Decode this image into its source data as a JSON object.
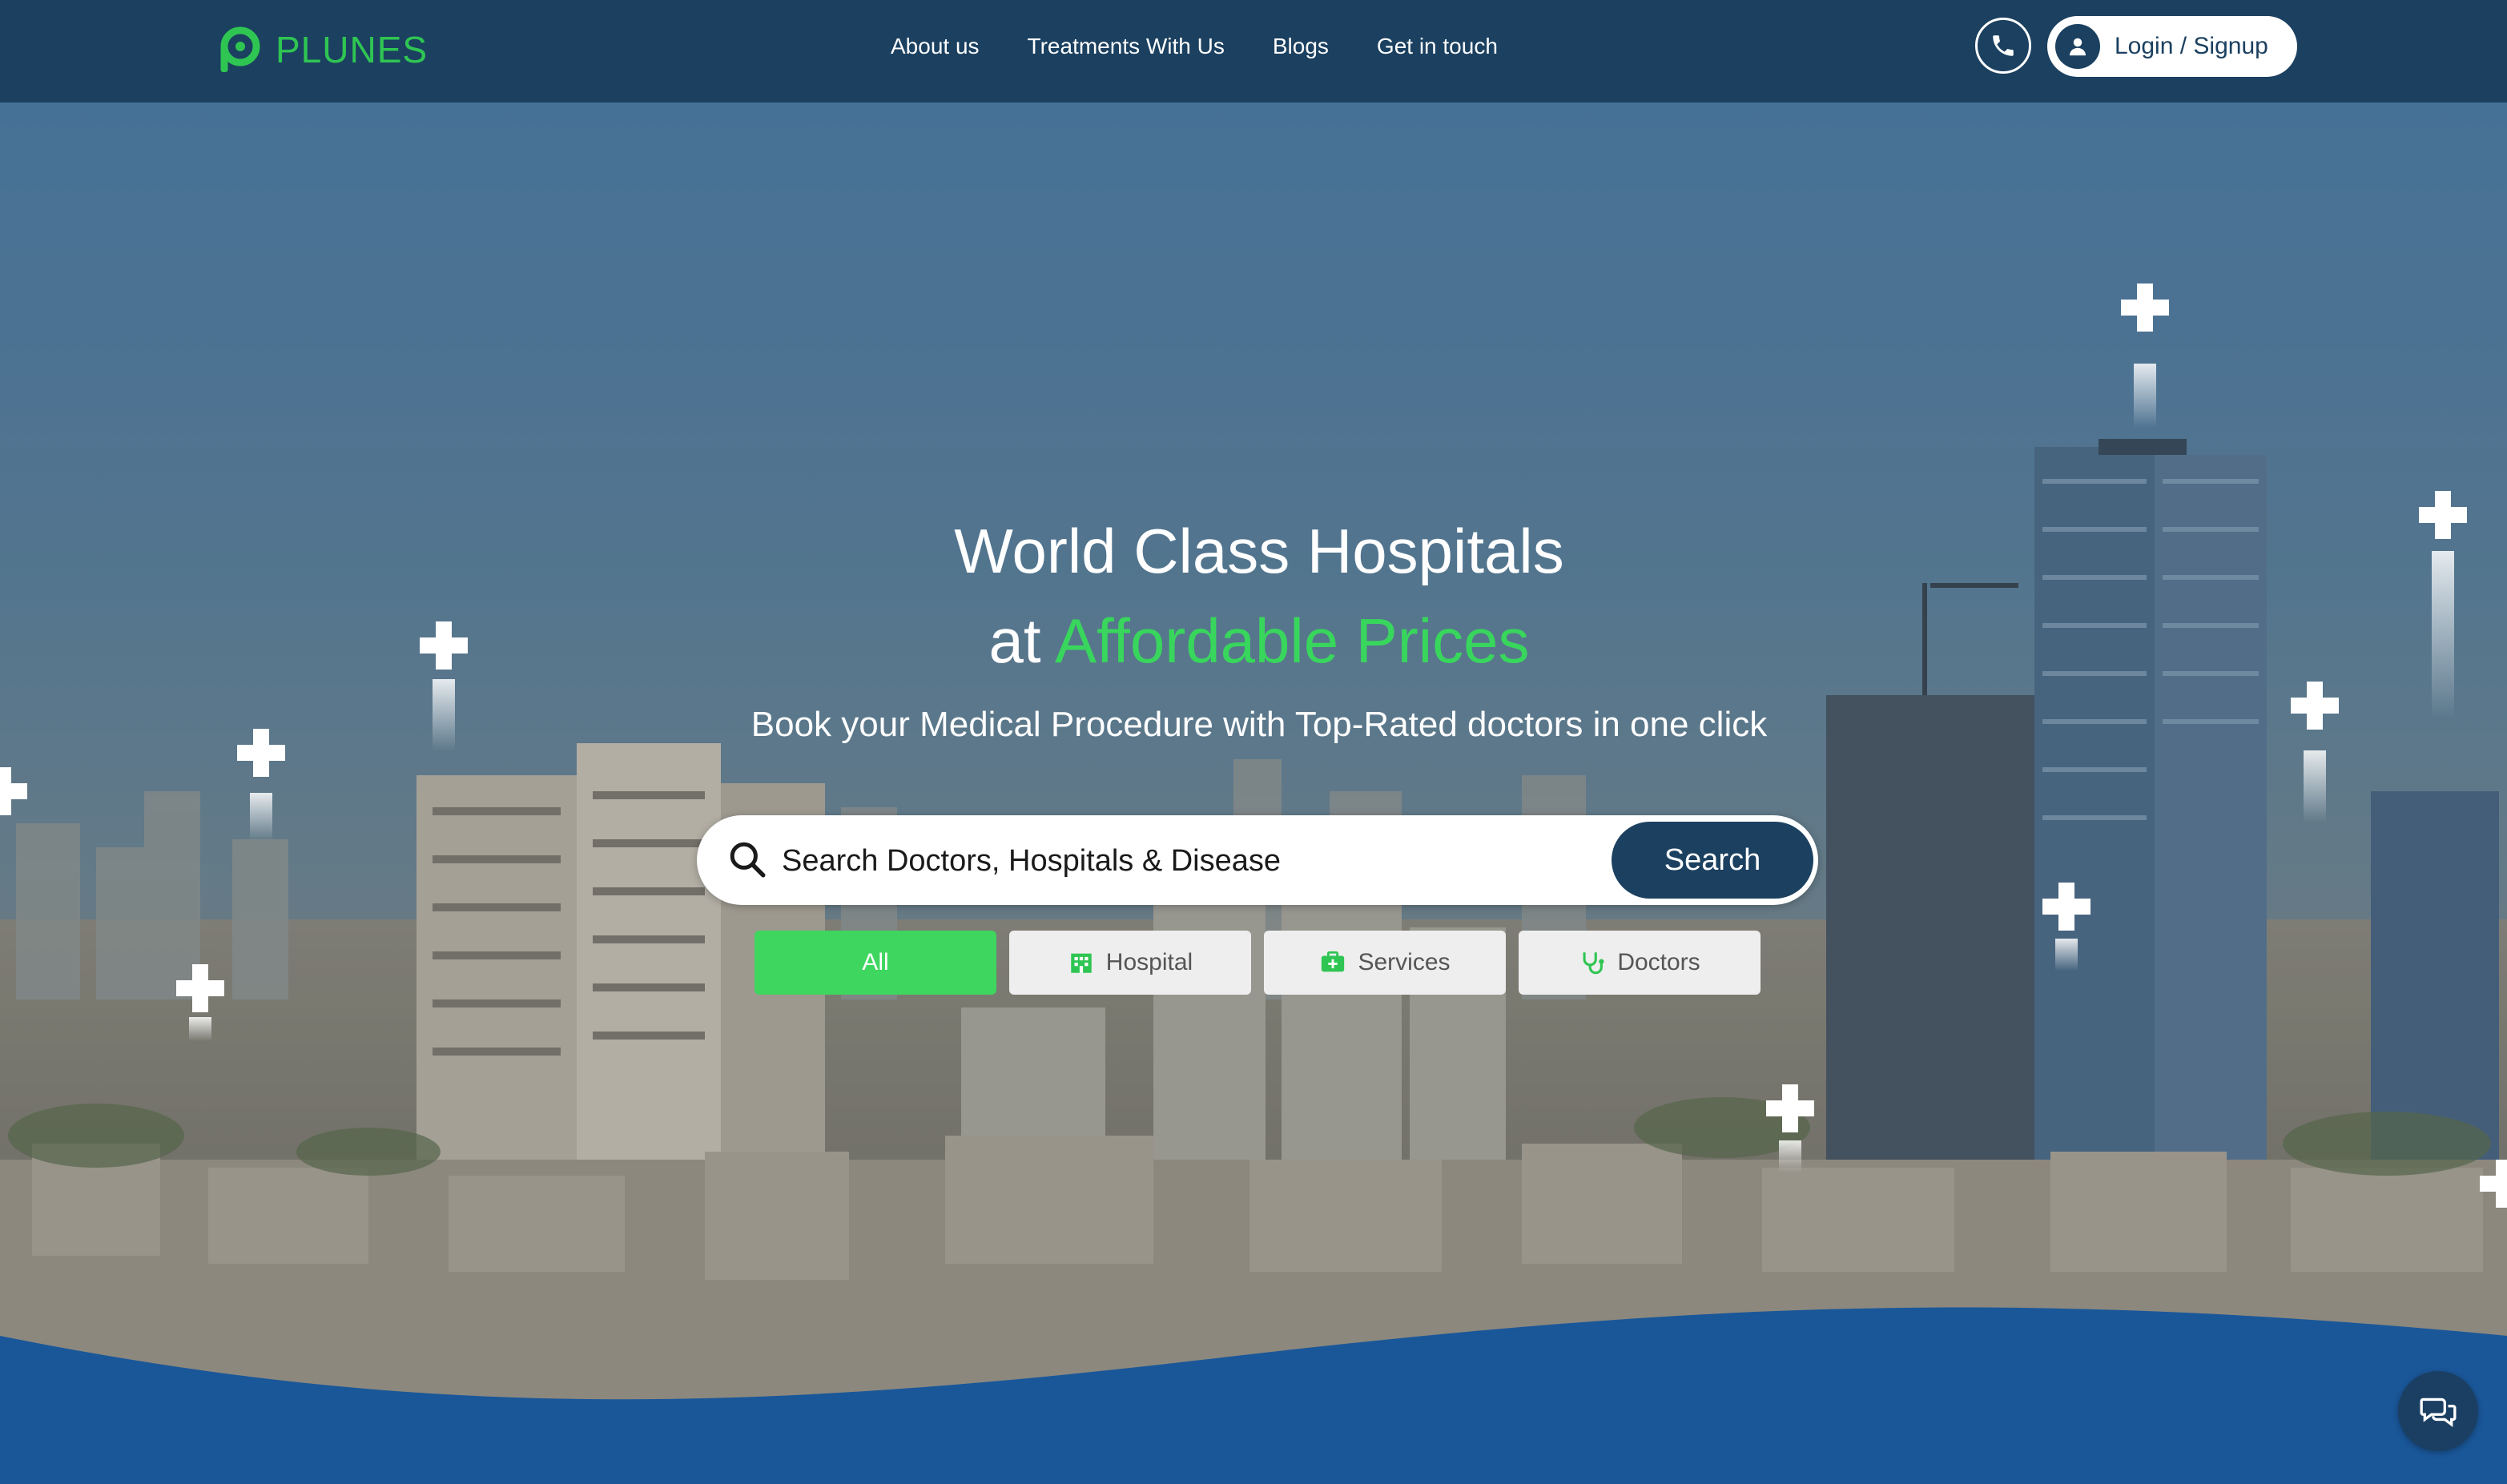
{
  "brand": {
    "name": "PLUNES",
    "color": "#2fc552"
  },
  "nav": {
    "links": [
      "About us",
      "Treatments With Us",
      "Blogs",
      "Get in touch"
    ],
    "login_label": "Login / Signup",
    "phone_icon": "phone-icon",
    "user_icon": "user-icon"
  },
  "hero": {
    "title_line1": "World Class Hospitals",
    "title_line2_prefix": "at ",
    "title_line2_accent": "Affordable Prices",
    "subtitle": "Book your Medical Procedure with Top-Rated doctors in one click",
    "accent_color": "#38d65c"
  },
  "search": {
    "placeholder": "Search Doctors, Hospitals & Disease",
    "button_label": "Search"
  },
  "filters": [
    {
      "label": "All",
      "icon": "",
      "active": true
    },
    {
      "label": "Hospital",
      "icon": "hospital-icon",
      "active": false
    },
    {
      "label": "Services",
      "icon": "medical-kit-icon",
      "active": false
    },
    {
      "label": "Doctors",
      "icon": "stethoscope-icon",
      "active": false
    }
  ],
  "chat": {
    "icon": "chat-icon"
  },
  "colors": {
    "nav_bg": "#1b4060",
    "wave": "#1a5799",
    "active_filter": "#3ed65e"
  }
}
